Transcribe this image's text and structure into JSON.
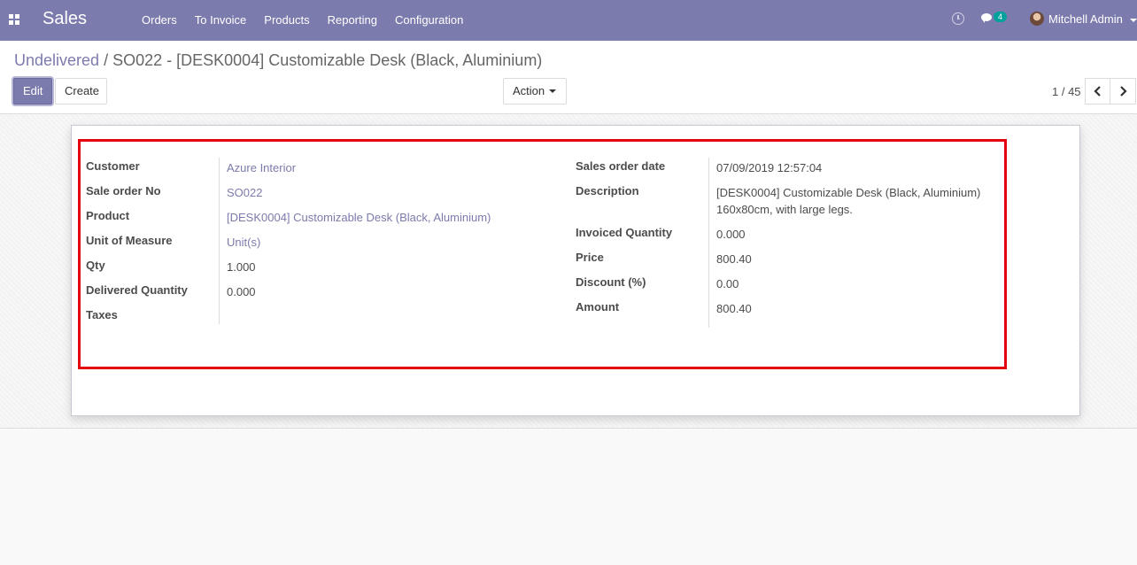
{
  "navbar": {
    "app_name": "Sales",
    "menu": [
      "Orders",
      "To Invoice",
      "Products",
      "Reporting",
      "Configuration"
    ],
    "chat_count": "4",
    "user_name": "Mitchell Admin",
    "icons": [
      "apps-icon",
      "clock-icon",
      "chat-icon",
      "avatar"
    ]
  },
  "breadcrumb": {
    "parent": "Undelivered",
    "separator": "/",
    "current": "SO022 - [DESK0004] Customizable Desk (Black, Aluminium)"
  },
  "buttons": {
    "edit": "Edit",
    "create": "Create",
    "action": "Action"
  },
  "pager": {
    "value": "1 / 45"
  },
  "form": {
    "left": [
      {
        "label": "Customer",
        "value": "Azure Interior"
      },
      {
        "label": "Sale order No",
        "value": "SO022"
      },
      {
        "label": "Product",
        "value": "[DESK0004] Customizable Desk (Black, Aluminium)"
      },
      {
        "label": "Unit of Measure",
        "value": "Unit(s)"
      },
      {
        "label": "Qty",
        "value": "1.000"
      },
      {
        "label": "Delivered Quantity",
        "value": "0.000"
      },
      {
        "label": "Taxes",
        "value": ""
      }
    ],
    "right": [
      {
        "label": "Sales order date",
        "value": "07/09/2019 12:57:04"
      },
      {
        "label": "Description",
        "value": "[DESK0004] Customizable Desk (Black, Aluminium) 160x80cm, with large legs."
      },
      {
        "label": "Invoiced Quantity",
        "value": "0.000"
      },
      {
        "label": "Price",
        "value": "800.40"
      },
      {
        "label": "Discount (%)",
        "value": "0.00"
      },
      {
        "label": "Amount",
        "value": "800.40"
      }
    ]
  },
  "colors": {
    "primary": "#7c7bad",
    "highlight": "#e3000f",
    "badge": "#00a09d"
  }
}
